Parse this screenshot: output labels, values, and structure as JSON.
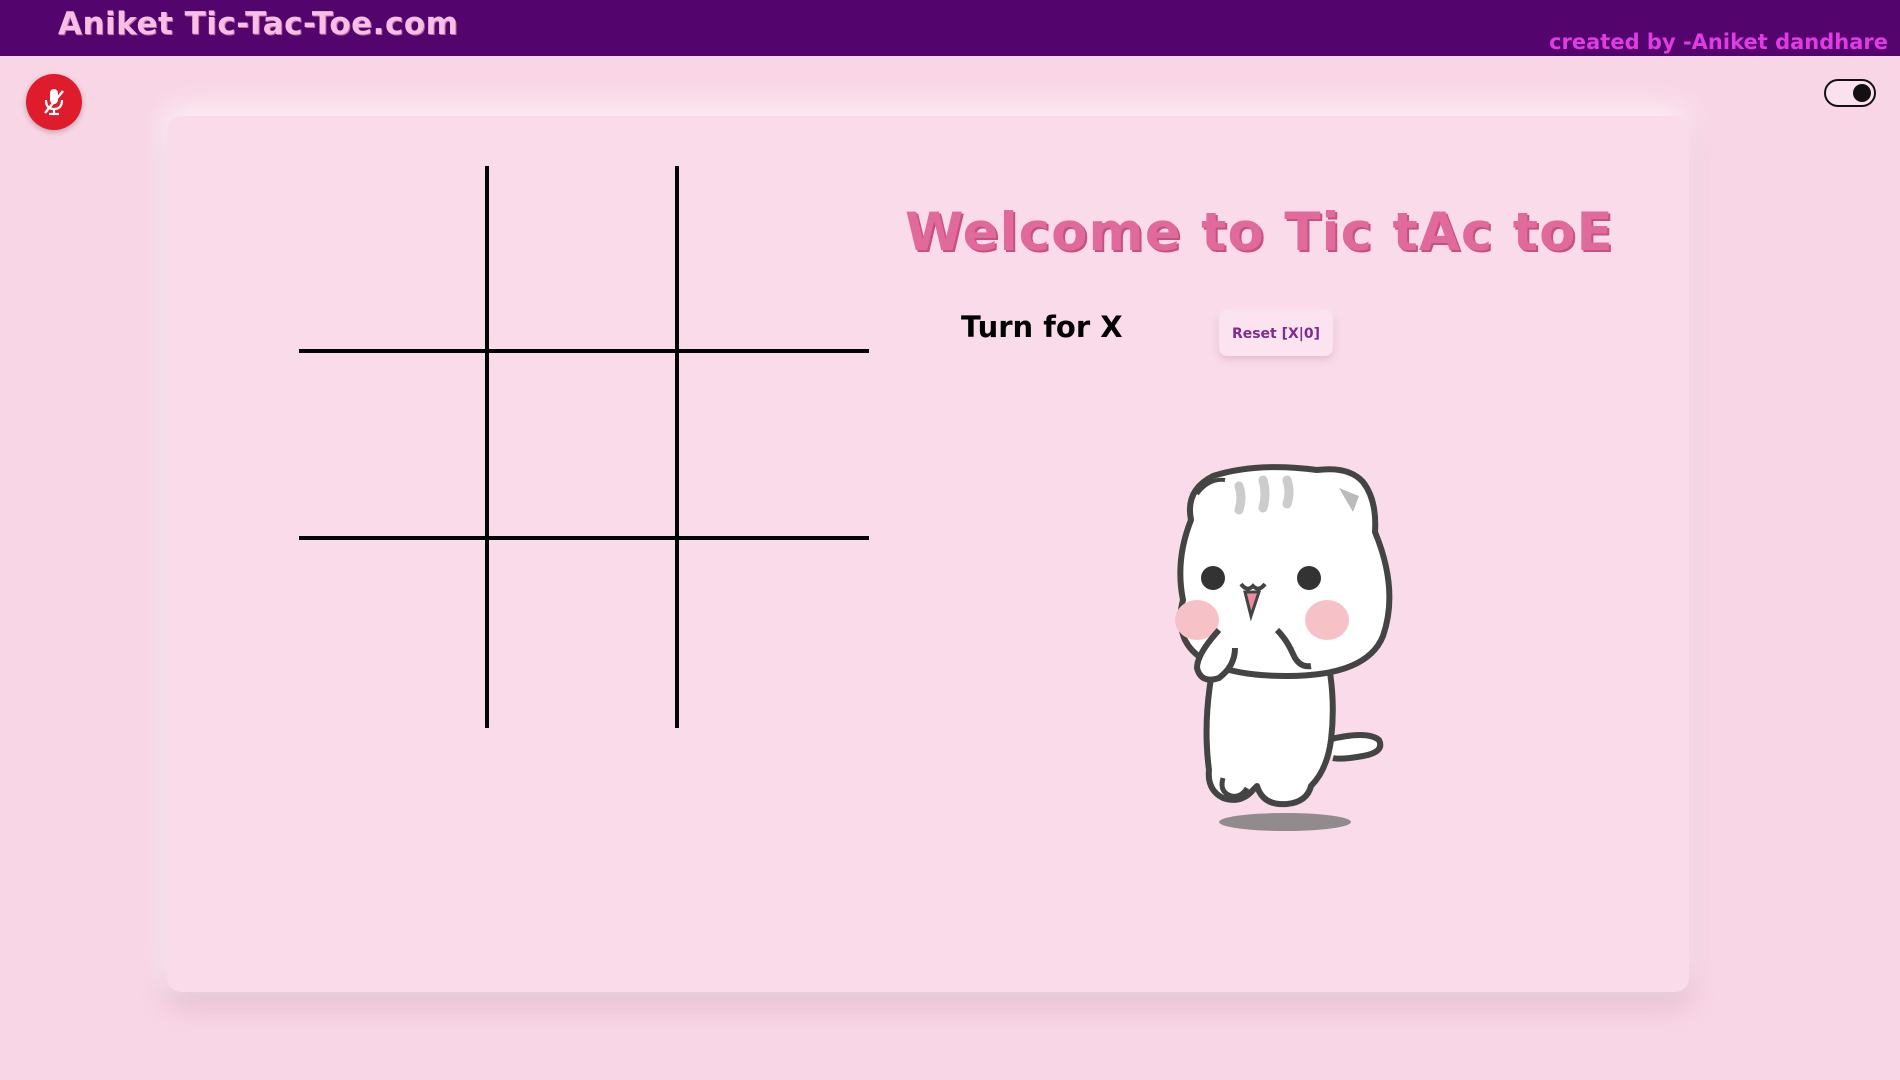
{
  "header": {
    "title": "Aniket Tic-Tac-Toe.com",
    "credit": "created by -Aniket dandhare"
  },
  "controls": {
    "mic_icon": "mic-off-icon",
    "theme_toggle_state": "on"
  },
  "game": {
    "welcome": "Welcome to Tic tAc toE",
    "turn": "Turn for X",
    "reset_label": "Reset [X|0]",
    "board": [
      "",
      "",
      "",
      "",
      "",
      "",
      "",
      "",
      ""
    ],
    "mascot": "cat-mascot-icon"
  },
  "colors": {
    "topbar": "#53046d",
    "background": "#f9d6e6",
    "title": "#f7bfe4",
    "credit": "#e13be3",
    "welcome": "#e06a9a",
    "mic_button": "#df1c2c"
  }
}
